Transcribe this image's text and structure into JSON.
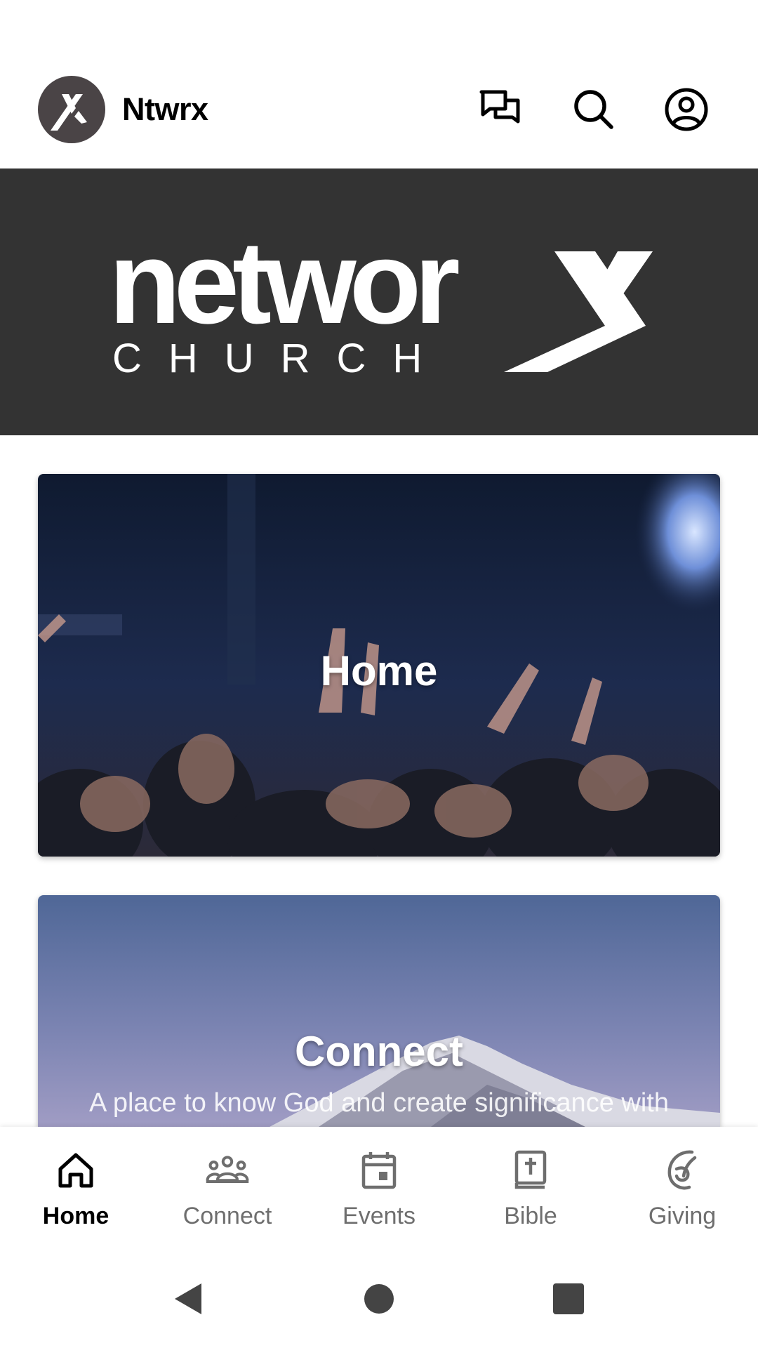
{
  "app": {
    "name": "Ntwrx"
  },
  "header": {
    "icons": [
      "x-logo-icon",
      "chat-icon",
      "search-icon",
      "account-circle-icon"
    ]
  },
  "banner": {
    "logo_word": "networx",
    "logo_sub": "C H U R C H"
  },
  "cards": [
    {
      "title": "Home"
    },
    {
      "title": "Connect",
      "subtitle": "A place to know God and create significance with"
    }
  ],
  "bottom_nav": {
    "items": [
      {
        "label": "Home",
        "icon": "home-icon",
        "active": true
      },
      {
        "label": "Connect",
        "icon": "groups-icon",
        "active": false
      },
      {
        "label": "Events",
        "icon": "calendar-icon",
        "active": false
      },
      {
        "label": "Bible",
        "icon": "bible-icon",
        "active": false
      },
      {
        "label": "Giving",
        "icon": "giving-icon",
        "active": false
      }
    ]
  },
  "system_nav": {
    "icons": [
      "back-icon",
      "home-circle-icon",
      "recents-icon"
    ]
  },
  "colors": {
    "banner_bg": "#333333",
    "avatar_bg": "#4a4446",
    "inactive": "#6e6e6e",
    "active": "#000000"
  }
}
